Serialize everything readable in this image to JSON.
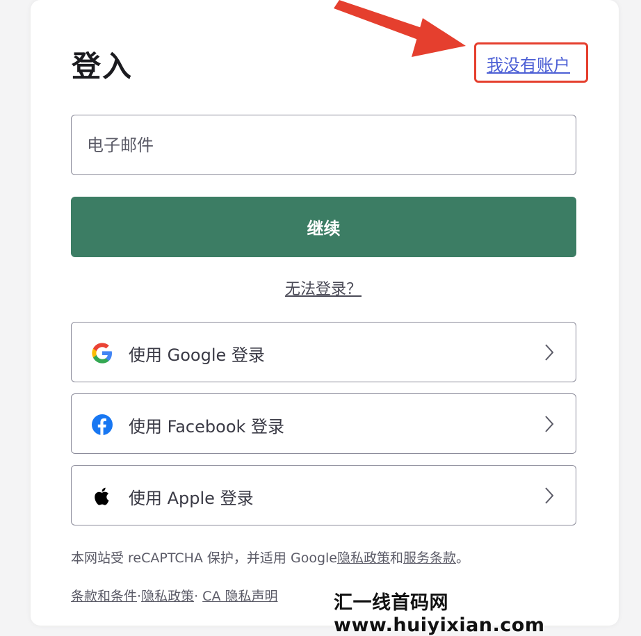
{
  "header": {
    "title": "登入",
    "signup_link": "我没有账户"
  },
  "form": {
    "email_placeholder": "电子邮件",
    "continue_label": "继续",
    "trouble_link": "无法登录？"
  },
  "social": [
    {
      "label": "使用 Google 登录",
      "icon": "google-icon"
    },
    {
      "label": "使用 Facebook 登录",
      "icon": "facebook-icon"
    },
    {
      "label": "使用 Apple 登录",
      "icon": "apple-icon"
    }
  ],
  "notice": {
    "prefix": "本网站受 reCAPTCHA 保护，并适用 Google",
    "privacy": "隐私政策",
    "and": "和",
    "terms": "服务条款",
    "suffix": "。"
  },
  "footer": {
    "terms_conditions": "条款和条件",
    "privacy_policy": "隐私政策",
    "ca_privacy": "CA 隐私声明",
    "sep1": "·",
    "sep2": "· "
  },
  "watermark": "汇一线首码网 www.huiyixian.com",
  "colors": {
    "primary": "#3c7d64",
    "link": "#4c5fd5",
    "highlight": "#e53f2e"
  }
}
